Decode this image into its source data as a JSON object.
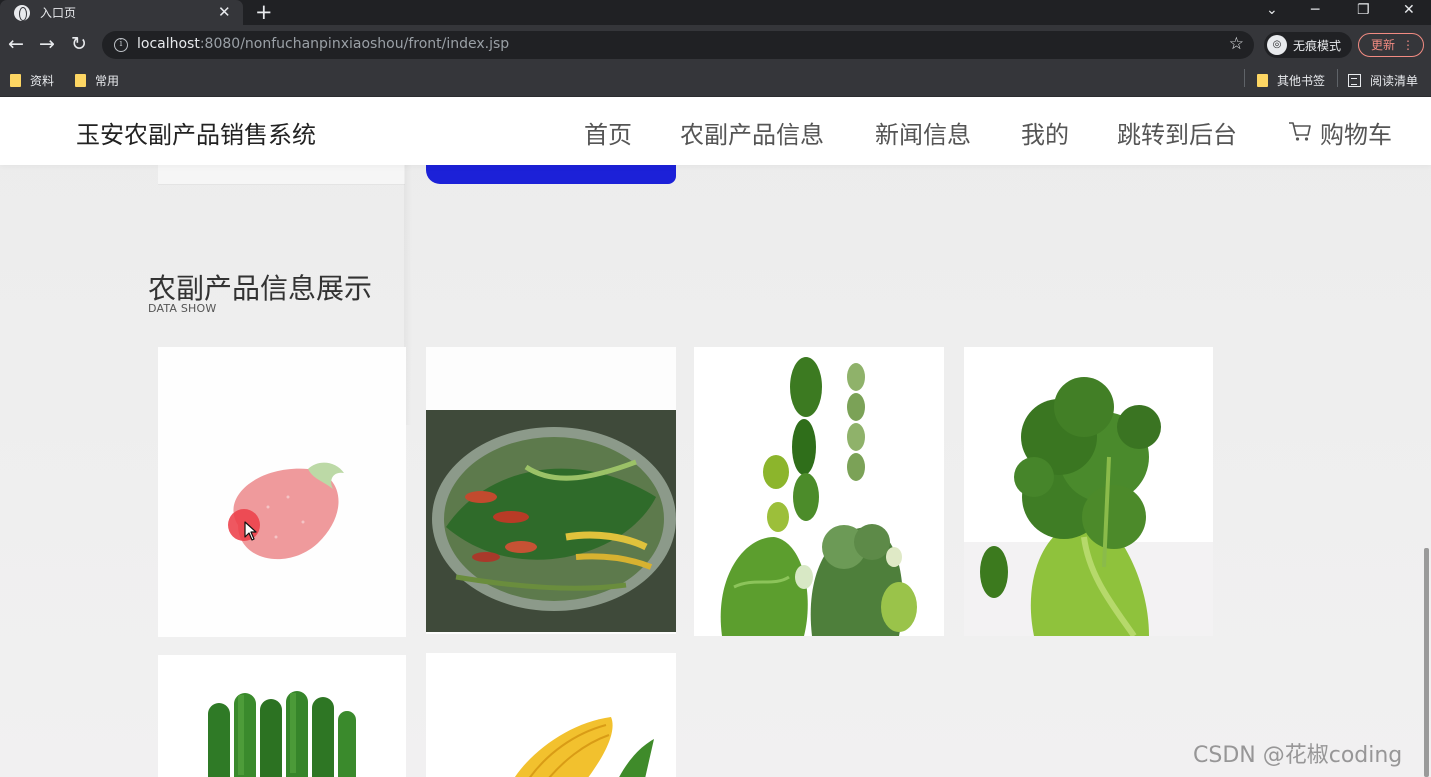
{
  "browser": {
    "tab_title": "入口页",
    "tab_close": "✕",
    "new_tab": "+",
    "url_host": "localhost",
    "url_rest": ":8080/nonfuchanpinxiaoshou/front/index.jsp",
    "incognito_label": "无痕模式",
    "update_label": "更新",
    "update_menu": "⋮",
    "bookmarks": [
      "资料",
      "常用"
    ],
    "bookmarks_right": [
      "其他书签",
      "阅读清单"
    ],
    "back_icon": "←",
    "forward_icon": "→",
    "reload_icon": "↻",
    "star_icon": "☆",
    "min_icon": "─",
    "restore_icon": "❐",
    "close_icon": "✕",
    "tabs_menu_icon": "⌄"
  },
  "site": {
    "title": "玉安农副产品销售系统",
    "nav": [
      "首页",
      "农副产品信息",
      "新闻信息",
      "我的",
      "跳转到后台",
      "购物车"
    ]
  },
  "section": {
    "title": "农副产品信息展示",
    "subtitle": "DATA SHOW"
  },
  "products": [
    {
      "image": "strawberry"
    },
    {
      "image": "vegetable-basin"
    },
    {
      "image": "green-vegetables"
    },
    {
      "image": "broccoli"
    },
    {
      "image": "cucumbers"
    },
    {
      "image": "corn"
    }
  ],
  "watermark": "CSDN @花椒coding",
  "colors": {
    "chrome_dark": "#202124",
    "chrome_mid": "#35363a",
    "page_bg": "#ededed",
    "accent_red": "#ed404a"
  }
}
